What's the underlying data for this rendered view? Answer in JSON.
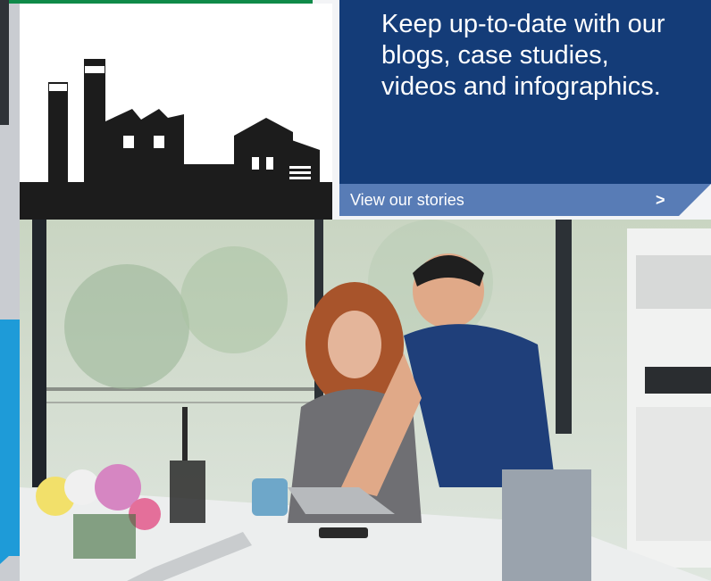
{
  "blog_panel": {
    "text": "Keep up-to-date with our blogs, case studies, videos and infographics.",
    "cta_label": "View our stories",
    "cta_arrow": ">"
  },
  "icons": {
    "industry": "factory-and-house-icon"
  },
  "hero": {
    "subject": "photo-couple-using-laptop-in-kitchen"
  },
  "colors": {
    "navy": "#143c78",
    "cta_blue": "#587cb6",
    "accent_blue": "#1e9bd8",
    "accent_green": "#0f8a49",
    "silhouette": "#1c1c1c"
  }
}
